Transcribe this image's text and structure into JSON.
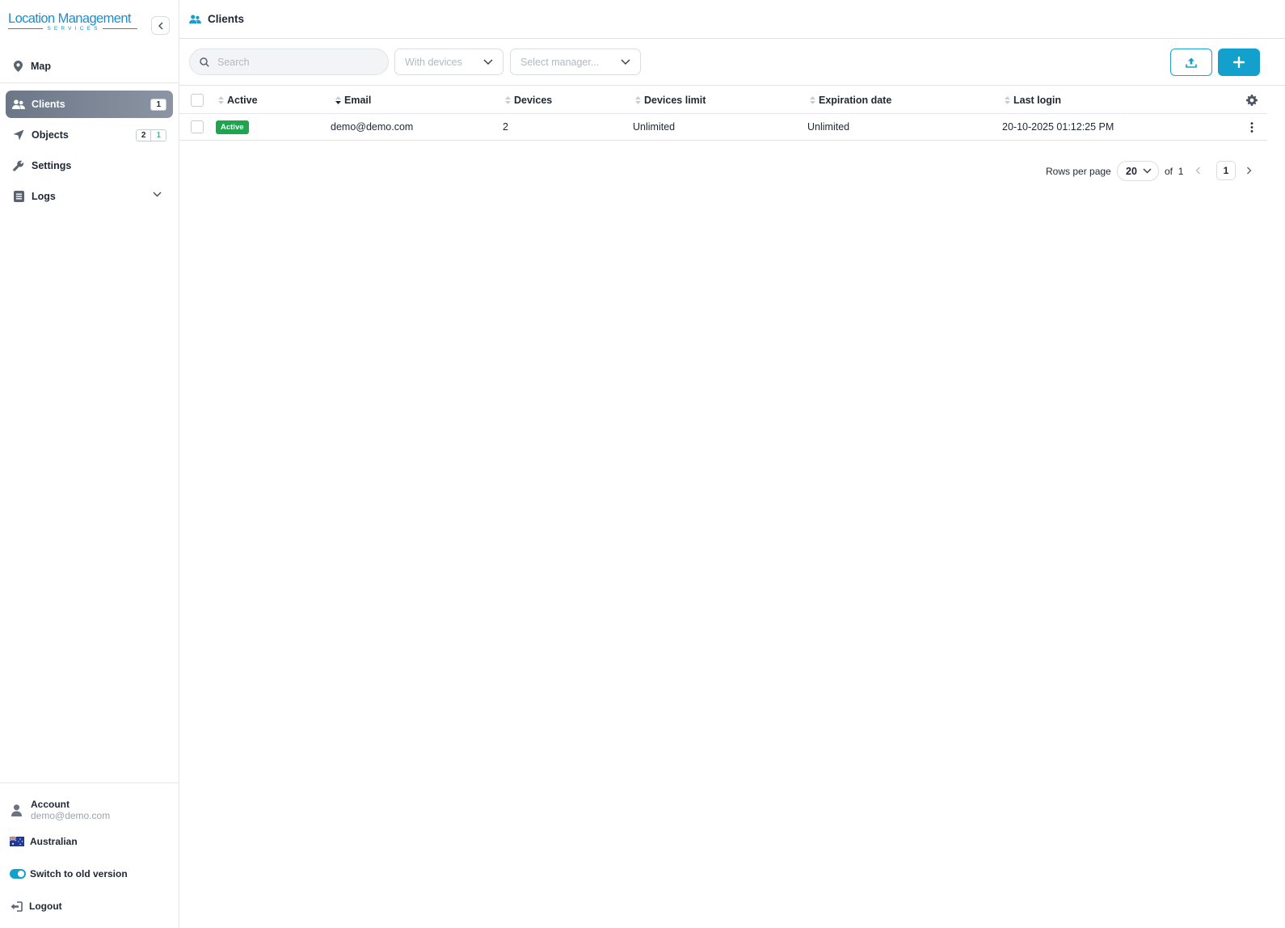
{
  "sidebar": {
    "logo_main": "Location Management",
    "logo_sub": "SERVICES",
    "top_item": {
      "label": "Map",
      "icon": "map-pin-icon"
    },
    "nav": [
      {
        "label": "Clients",
        "icon": "users-icon",
        "badge": "1",
        "active": true
      },
      {
        "label": "Objects",
        "icon": "location-arrow-icon",
        "badge": "2",
        "badge_green": "1"
      },
      {
        "label": "Settings",
        "icon": "wrench-icon"
      },
      {
        "label": "Logs",
        "icon": "list-icon",
        "expandable": true
      }
    ],
    "account": {
      "label": "Account",
      "email": "demo@demo.com"
    },
    "language": "Australian",
    "switch_label": "Switch to old version",
    "logout_label": "Logout"
  },
  "header": {
    "title": "Clients"
  },
  "toolbar": {
    "search_placeholder": "Search",
    "filter_devices": "With devices",
    "filter_manager": "Select manager..."
  },
  "table": {
    "columns": [
      "Active",
      "Email",
      "Devices",
      "Devices limit",
      "Expiration date",
      "Last login"
    ],
    "rows": [
      {
        "active": "Active",
        "email": "demo@demo.com",
        "devices": "2",
        "devices_limit": "Unlimited",
        "expiration": "Unlimited",
        "last_login": "20-10-2025 01:12:25 PM"
      }
    ]
  },
  "pagination": {
    "rows_per_page_label": "Rows per page",
    "rows_per_page": "20",
    "of_label": "of",
    "total_pages": "1",
    "current_page": "1"
  },
  "colors": {
    "accent": "#13a0cc",
    "active_nav": "#7a8494",
    "status_green": "#1fa44f"
  }
}
